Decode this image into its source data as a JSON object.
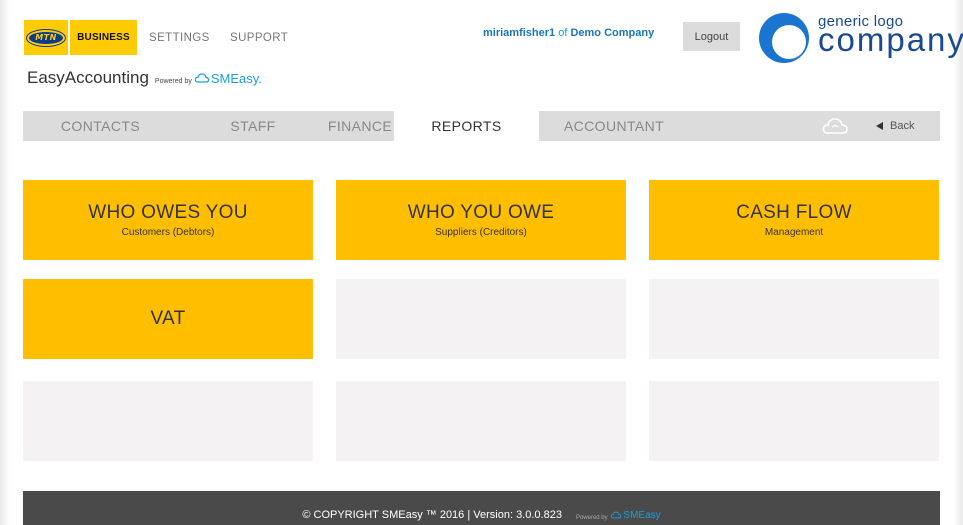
{
  "header": {
    "mtn_logo_text": "MTN",
    "business_tab": "BUSINESS",
    "links": [
      "SETTINGS",
      "SUPPORT"
    ],
    "brand_name": "EasyAccounting",
    "powered_by": "Powered by",
    "smeasy": "SMEasy.",
    "user": "miriamfisher1",
    "of_text": "of",
    "company": "Demo Company",
    "logout": "Logout",
    "logo_small": "generic logo",
    "logo_big": "company"
  },
  "nav": {
    "tabs": [
      "CONTACTS",
      "STAFF",
      "FINANCE",
      "REPORTS",
      "ACCOUNTANT"
    ],
    "active": "REPORTS",
    "back": "Back"
  },
  "tiles": [
    {
      "title": "WHO OWES YOU",
      "subtitle": "Customers (Debtors)"
    },
    {
      "title": "WHO YOU OWE",
      "subtitle": "Suppliers (Creditors)"
    },
    {
      "title": "CASH FLOW",
      "subtitle": "Management"
    },
    {
      "title": "VAT",
      "subtitle": ""
    }
  ],
  "footer": {
    "copyright": "© COPYRIGHT SMEasy ™ 2016 | Version: 3.0.0.823",
    "powered_by": "Powered by",
    "smeasy": "SMEasy"
  },
  "colors": {
    "accent_yellow": "#ffbf00",
    "mtn_yellow": "#ffcb05",
    "link_blue": "#1a9fd8",
    "logo_blue": "#1a4a8f",
    "footer_bg": "#4a4a4a"
  }
}
